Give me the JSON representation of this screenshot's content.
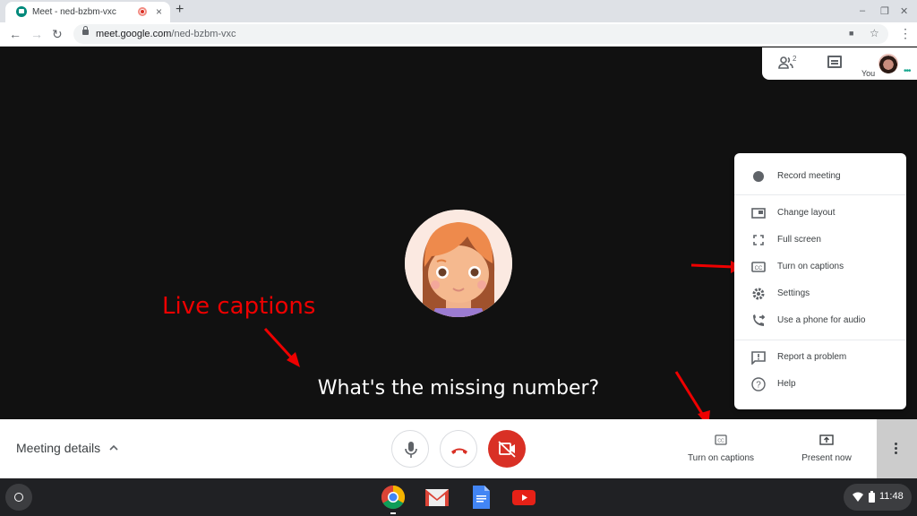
{
  "browser": {
    "tab_title": "Meet - ned-bzbm-vxc",
    "tab_close": "×",
    "new_tab": "+",
    "url_host": "meet.google.com",
    "url_path": "/ned-bzbm-vxc",
    "window_controls": {
      "minimize": "–",
      "restore": "❐",
      "close": "✕"
    },
    "nav": {
      "back": "←",
      "forward": "→",
      "reload": "↻"
    },
    "omnibox_icons": {
      "camera": "■",
      "star": "☆"
    },
    "menu": "⋮"
  },
  "people_panel": {
    "participant_count": "2",
    "self_label": "You",
    "dots": "•••"
  },
  "annotation": {
    "text": "Live captions",
    "color": "#e00000"
  },
  "caption_text": "What's the missing number?",
  "overflow_menu": {
    "items": [
      {
        "label": "Record meeting",
        "icon": "record-icon"
      },
      {
        "label": "Change layout",
        "icon": "layout-icon"
      },
      {
        "label": "Full screen",
        "icon": "fullscreen-icon"
      },
      {
        "label": "Turn on captions",
        "icon": "captions-icon"
      },
      {
        "label": "Settings",
        "icon": "gear-icon"
      },
      {
        "label": "Use a phone for audio",
        "icon": "phone-audio-icon"
      },
      {
        "label": "Report a problem",
        "icon": "report-icon"
      },
      {
        "label": "Help",
        "icon": "help-icon"
      }
    ]
  },
  "bottom_bar": {
    "meeting_details": "Meeting details",
    "chevron": "⌃",
    "captions_label": "Turn on captions",
    "present_label": "Present now",
    "end_call_color": "#d93025"
  },
  "shelf": {
    "time": "11:48",
    "apps": [
      "chrome",
      "gmail",
      "docs",
      "youtube"
    ]
  }
}
